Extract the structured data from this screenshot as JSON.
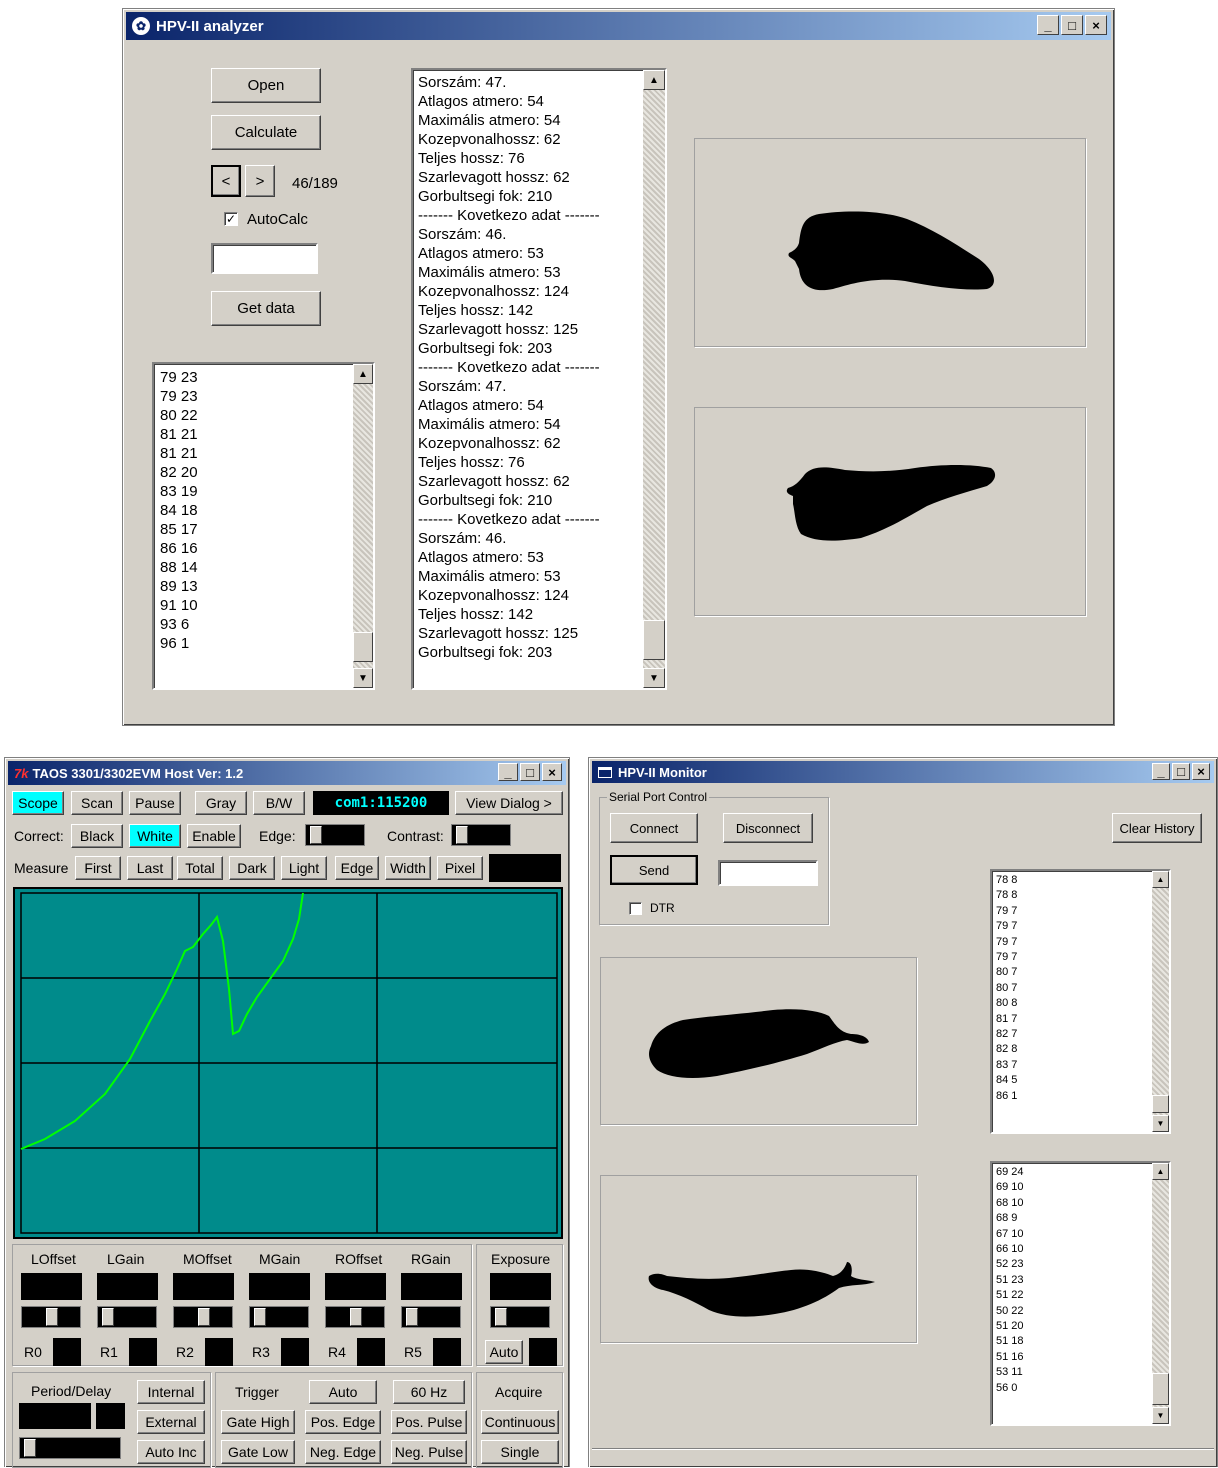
{
  "analyzer": {
    "title": "HPV-II analyzer",
    "open": "Open",
    "calculate": "Calculate",
    "prev": "<",
    "next": ">",
    "counter": "46/189",
    "autocalc": "AutoCalc",
    "get_data": "Get data",
    "points_list": [
      "79 23",
      "79 23",
      "80 22",
      "81 21",
      "81 21",
      "82 20",
      "83 19",
      "84 18",
      "85 17",
      "86 16",
      "88 14",
      "89 13",
      "91 10",
      "93 6",
      "96 1"
    ],
    "results_list": [
      "Sorszám: 47.",
      "Atlagos atmero: 54",
      "Maximális atmero: 54",
      "Kozepvonalhossz: 62",
      "Teljes hossz: 76",
      "Szarlevagott hossz: 62",
      "Gorbultsegi fok: 210",
      "------- Kovetkezo adat -------",
      "Sorszám: 46.",
      "Atlagos atmero: 53",
      "Maximális atmero: 53",
      "Kozepvonalhossz: 124",
      "Teljes hossz: 142",
      "Szarlevagott hossz: 125",
      "Gorbultsegi fok: 203",
      "------- Kovetkezo adat -------",
      "Sorszám: 47.",
      "Atlagos atmero: 54",
      "Maximális atmero: 54",
      "Kozepvonalhossz: 62",
      "Teljes hossz: 76",
      "Szarlevagott hossz: 62",
      "Gorbultsegi fok: 210",
      "------- Kovetkezo adat -------",
      "Sorszám: 46.",
      "Atlagos atmero: 53",
      "Maximális atmero: 53",
      "Kozepvonalhossz: 124",
      "Teljes hossz: 142",
      "Szarlevagott hossz: 125",
      "Gorbultsegi fok: 203"
    ]
  },
  "taos": {
    "title": "TAOS 3301/3302EVM Host Ver: 1.2",
    "row1": {
      "scope": "Scope",
      "scan": "Scan",
      "pause": "Pause",
      "gray": "Gray",
      "bw": "B/W",
      "com": "com1:115200",
      "view": "View Dialog >"
    },
    "row2": {
      "correct": "Correct:",
      "black": "Black",
      "white": "White",
      "enable": "Enable",
      "edge": "Edge:",
      "contrast": "Contrast:"
    },
    "row3": {
      "measure": "Measure",
      "first": "First",
      "last": "Last",
      "total": "Total",
      "dark": "Dark",
      "light": "Light",
      "edge": "Edge",
      "width": "Width",
      "pixel": "Pixel"
    },
    "channels": [
      "LOffset",
      "LGain",
      "MOffset",
      "MGain",
      "ROffset",
      "RGain"
    ],
    "regs": [
      "R0",
      "R1",
      "R2",
      "R3",
      "R4",
      "R5"
    ],
    "exposure": "Exposure",
    "auto": "Auto",
    "period": "Period/Delay",
    "internal": "Internal",
    "external": "External",
    "autoinc": "Auto Inc",
    "trigger": "Trigger",
    "trig_auto": "Auto",
    "hz": "60 Hz",
    "gate_high": "Gate High",
    "pos_edge": "Pos. Edge",
    "pos_pulse": "Pos. Pulse",
    "gate_low": "Gate Low",
    "neg_edge": "Neg. Edge",
    "neg_pulse": "Neg. Pulse",
    "acquire": "Acquire",
    "continuous": "Continuous",
    "single": "Single",
    "colors": {
      "scope_bg": "#008b8b",
      "trace": "#00ff00",
      "active": "#00ffff"
    }
  },
  "monitor": {
    "title": "HPV-II Monitor",
    "serial_group": "Serial Port Control",
    "connect": "Connect",
    "disconnect": "Disconnect",
    "send": "Send",
    "dtr": "DTR",
    "clear_history": "Clear History",
    "list1": [
      "78 8",
      "78 8",
      "79 7",
      "79 7",
      "79 7",
      "79 7",
      "80 7",
      "80 7",
      "80 8",
      "81 7",
      "82 7",
      "82 8",
      "83 7",
      "84 5",
      "86 1"
    ],
    "list2": [
      "69 24",
      "69 10",
      "68 10",
      "68 9",
      "67 10",
      "66 10",
      "52 23",
      "51 23",
      "51 22",
      "50 22",
      "51 20",
      "51 18",
      "51 16",
      "53 11",
      "56 0"
    ]
  }
}
